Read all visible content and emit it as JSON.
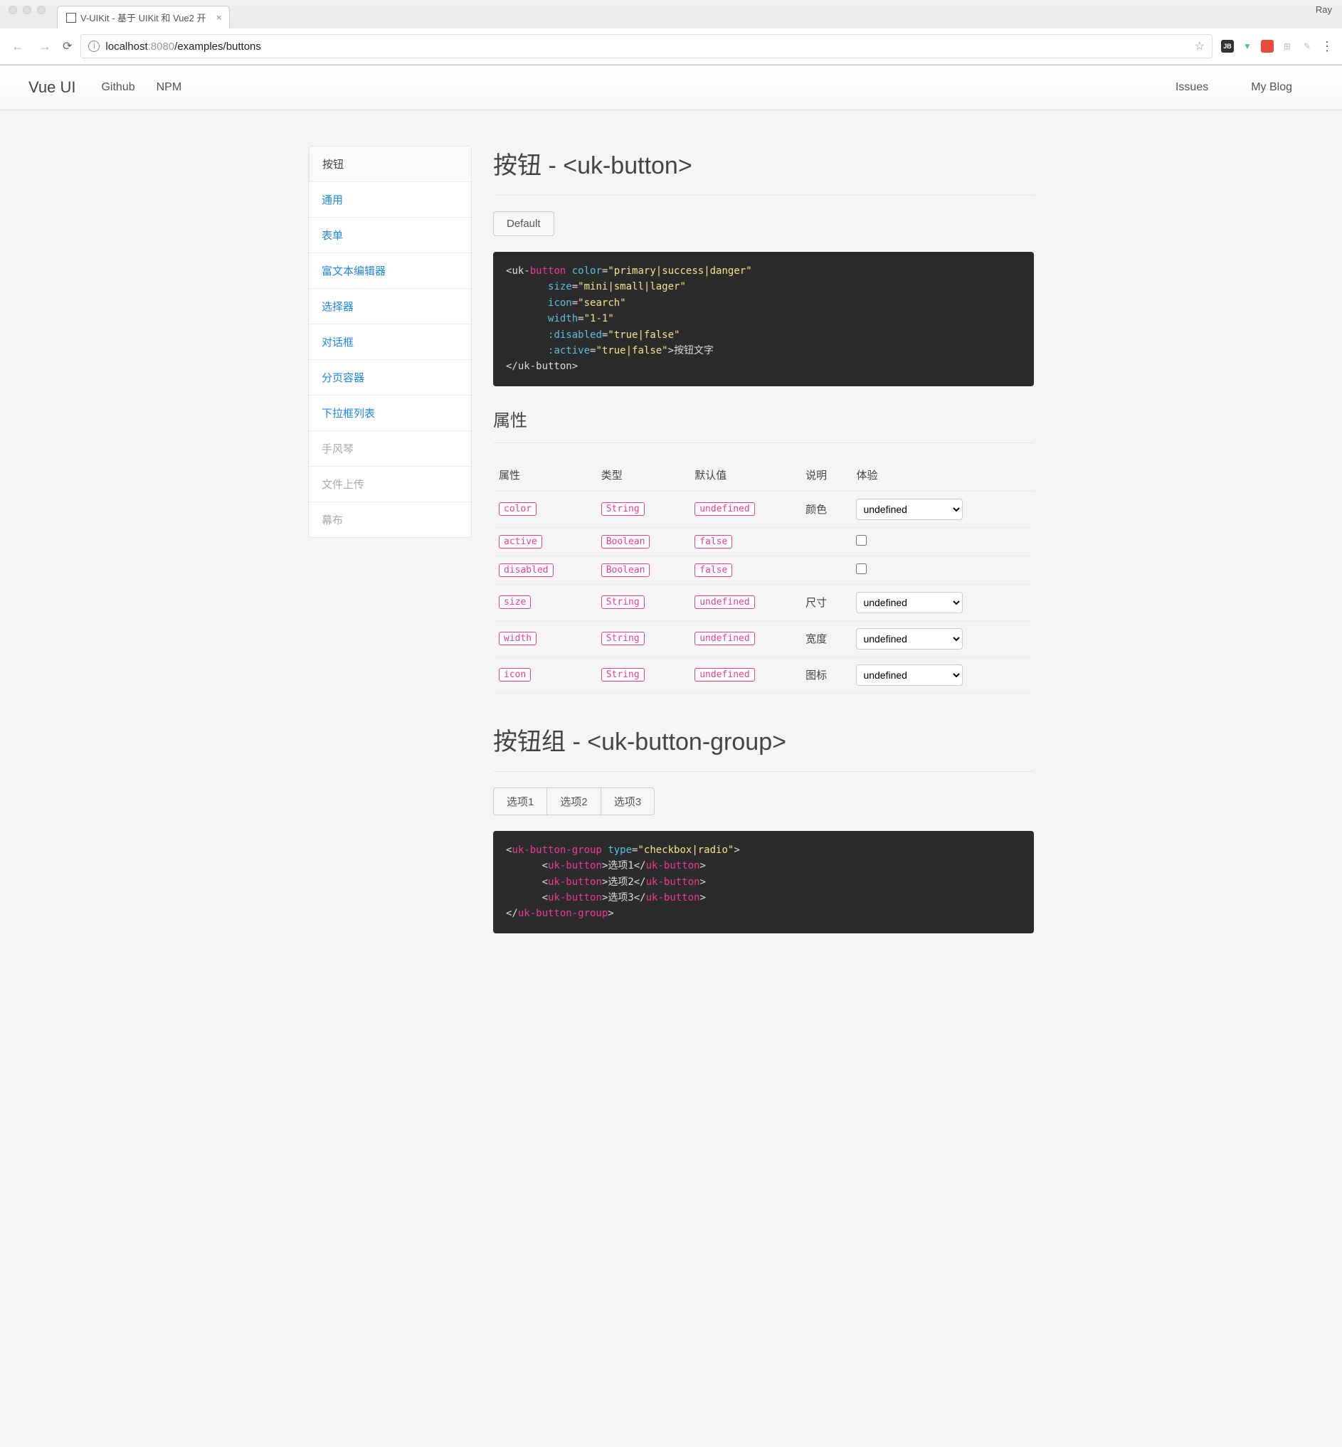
{
  "browser": {
    "tab_title": "V-UIKit - 基于 UIKit 和 Vue2 开",
    "profile": "Ray",
    "url_host": "localhost",
    "url_port": ":8080",
    "url_path": "/examples/buttons"
  },
  "nav": {
    "brand": "Vue UI",
    "links": [
      "Github",
      "NPM"
    ],
    "right": [
      "Issues",
      "My Blog"
    ]
  },
  "sidebar": {
    "items": [
      {
        "label": "按钮",
        "state": "active"
      },
      {
        "label": "通用",
        "state": "link"
      },
      {
        "label": "表单",
        "state": "link"
      },
      {
        "label": "富文本编辑器",
        "state": "link"
      },
      {
        "label": "选择器",
        "state": "link"
      },
      {
        "label": "对话框",
        "state": "link"
      },
      {
        "label": "分页容器",
        "state": "link"
      },
      {
        "label": "下拉框列表",
        "state": "link"
      },
      {
        "label": "手风琴",
        "state": "disabled"
      },
      {
        "label": "文件上传",
        "state": "disabled"
      },
      {
        "label": "幕布",
        "state": "disabled"
      }
    ]
  },
  "section1": {
    "title": "按钮 - <uk-button>",
    "default_btn": "Default",
    "code": {
      "tag_open": "uk-",
      "tag_name": "button",
      "attrs": [
        {
          "name": "color",
          "val": "\"primary|success|danger\""
        },
        {
          "name": "size",
          "val": "\"mini|small|lager\""
        },
        {
          "name": "icon",
          "val": "\"search\""
        },
        {
          "name": "width",
          "val": "\"1-1\""
        },
        {
          "name": ":disabled",
          "val": "\"true|false\""
        },
        {
          "name": ":active",
          "val": "\"true|false\""
        }
      ],
      "inner_text": "按钮文字",
      "close": "</uk-button>"
    }
  },
  "props": {
    "heading": "属性",
    "headers": [
      "属性",
      "类型",
      "默认值",
      "说明",
      "体验"
    ],
    "rows": [
      {
        "prop": "color",
        "type": "String",
        "default": "undefined",
        "desc": "颜色",
        "control": "select",
        "value": "undefined"
      },
      {
        "prop": "active",
        "type": "Boolean",
        "default": "false",
        "desc": "",
        "control": "checkbox",
        "value": ""
      },
      {
        "prop": "disabled",
        "type": "Boolean",
        "default": "false",
        "desc": "",
        "control": "checkbox",
        "value": ""
      },
      {
        "prop": "size",
        "type": "String",
        "default": "undefined",
        "desc": "尺寸",
        "control": "select",
        "value": "undefined"
      },
      {
        "prop": "width",
        "type": "String",
        "default": "undefined",
        "desc": "宽度",
        "control": "select",
        "value": "undefined"
      },
      {
        "prop": "icon",
        "type": "String",
        "default": "undefined",
        "desc": "图标",
        "control": "select",
        "value": "undefined"
      }
    ]
  },
  "section2": {
    "title": "按钮组 - <uk-button-group>",
    "buttons": [
      "选项1",
      "选项2",
      "选项3"
    ],
    "code": {
      "group_tag": "uk-button-group",
      "type_attr": "type",
      "type_val": "\"checkbox|radio\"",
      "item_tag": "uk-button",
      "items": [
        "选项1",
        "选项2",
        "选项3"
      ],
      "close": "</",
      "close2": ">"
    }
  }
}
